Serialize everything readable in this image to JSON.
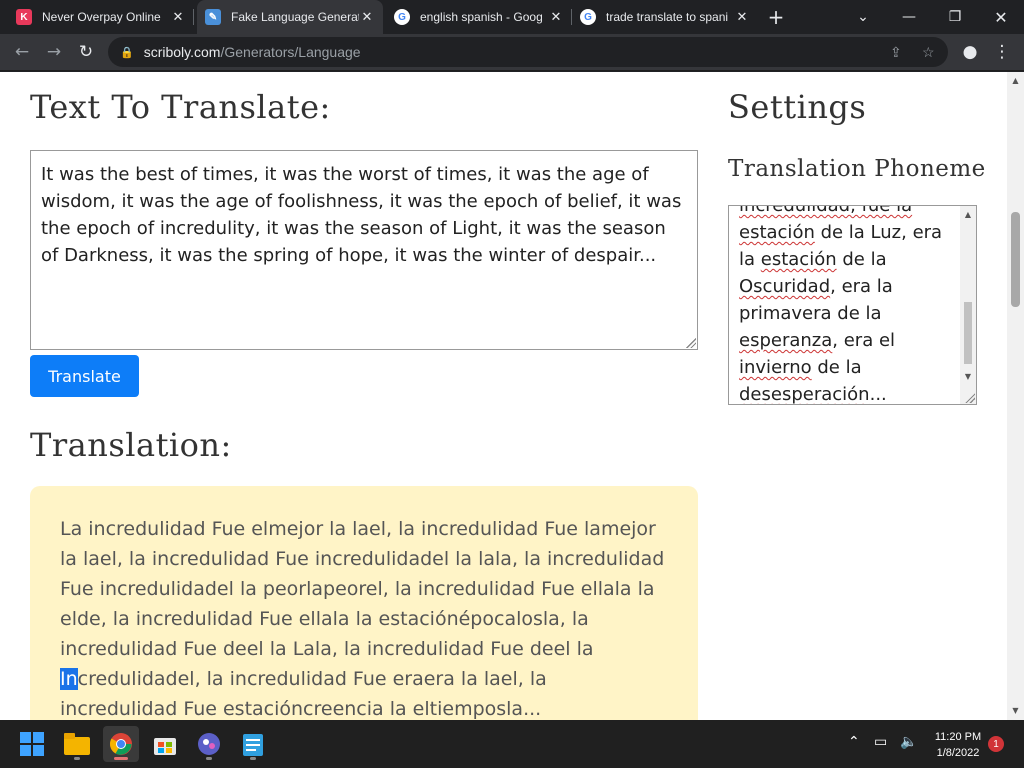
{
  "browser": {
    "tabs": [
      {
        "title": "Never Overpay Online",
        "favicon": "K",
        "favicon_color": "#e8395b",
        "active": false
      },
      {
        "title": "Fake Language Generat",
        "favicon": "notebook-icon",
        "favicon_color": "#4a90d9",
        "active": true
      },
      {
        "title": "english spanish - Goog",
        "favicon": "google-icon",
        "favicon_color": "#ffffff",
        "active": false
      },
      {
        "title": "trade translate to spani",
        "favicon": "google-icon",
        "favicon_color": "#ffffff",
        "active": false
      }
    ],
    "new_tab": "+",
    "url_domain": "scriboly.com",
    "url_path": "/Generators/Language"
  },
  "page": {
    "input_heading": "Text To Translate:",
    "input_text": "It was the best of times, it was the worst of times, it was the age of wisdom, it was the age of foolishness, it was the epoch of belief, it was the epoch of incredulity, it was the season of Light, it was the season of Darkness, it was the spring of hope, it was the winter of despair...",
    "translate_button": "Translate",
    "translation_heading": "Translation:",
    "translation_before": "La incredulidad Fue elmejor la lael, la incredulidad Fue lamejor la lael, la incredulidad Fue incredulidadel la lala, la incredulidad Fue incredulidadel la peorlapeorel, la incredulidad Fue ellala la elde, la incredulidad Fue ellala la estaciónépocalosla, la incredulidad Fue deel la Lala, la incredulidad Fue deel la ",
    "translation_selected": "In",
    "translation_after": "credulidadel, la incredulidad Fue eraera la lael, la incredulidad Fue estacióncreencia la eltiemposla...",
    "settings_heading": "Settings",
    "phoneme_heading": "Translation Phoneme",
    "phoneme_lines": [
      {
        "parts": [
          {
            "t": "incredulidad, fue la",
            "sq": true
          }
        ]
      },
      {
        "parts": [
          {
            "t": "estación",
            "sq": true
          },
          {
            "t": " de la Luz, era",
            "sq": false
          }
        ]
      },
      {
        "parts": [
          {
            "t": "la ",
            "sq": false
          },
          {
            "t": "estación",
            "sq": true
          },
          {
            "t": " de la",
            "sq": false
          }
        ]
      },
      {
        "parts": [
          {
            "t": "Oscuridad",
            "sq": true
          },
          {
            "t": ", era la",
            "sq": false
          }
        ]
      },
      {
        "parts": [
          {
            "t": "primavera de la",
            "sq": false
          }
        ]
      },
      {
        "parts": [
          {
            "t": "esperanza",
            "sq": true
          },
          {
            "t": ", era el",
            "sq": false
          }
        ]
      },
      {
        "parts": [
          {
            "t": "invierno",
            "sq": true
          },
          {
            "t": " de la",
            "sq": false
          }
        ]
      },
      {
        "parts": [
          {
            "t": "desesperación",
            "sq": true
          },
          {
            "t": "...",
            "sq": false
          }
        ]
      }
    ]
  },
  "taskbar": {
    "time": "11:20 PM",
    "date": "1/8/2022",
    "notifications": "1"
  }
}
